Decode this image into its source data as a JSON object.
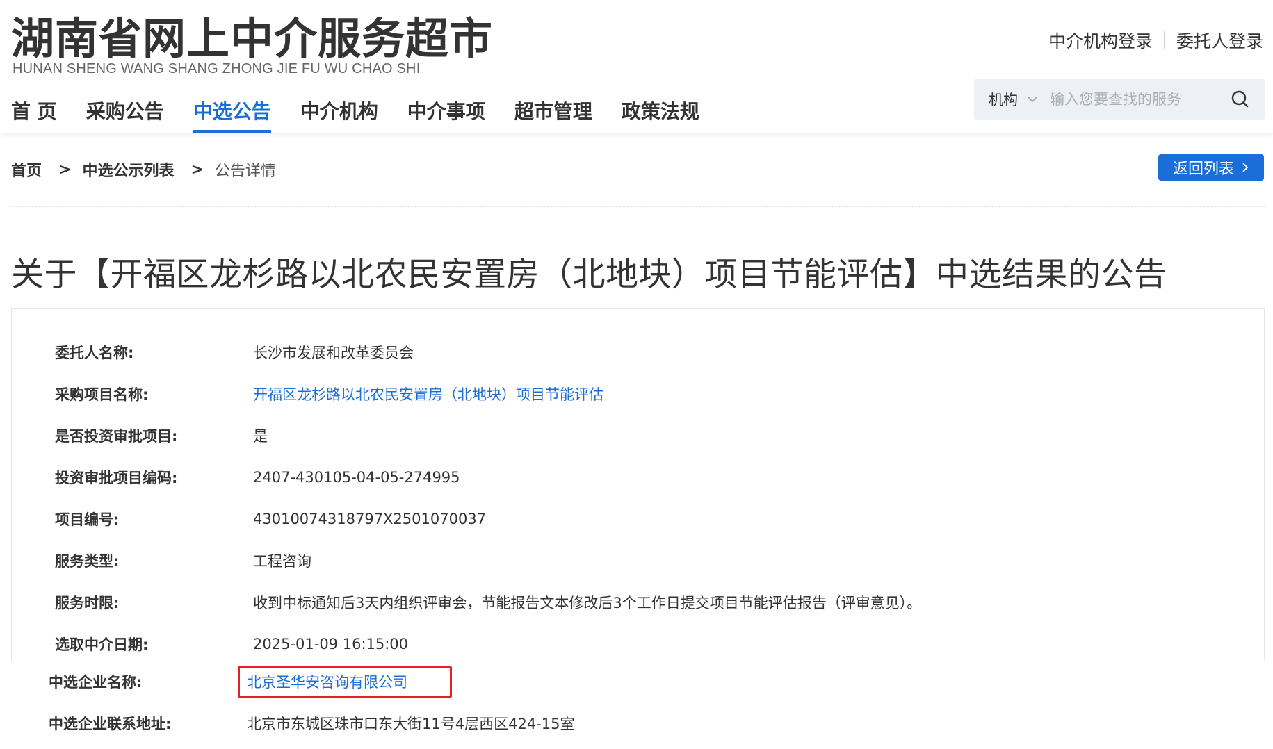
{
  "header": {
    "logo_cn": "湖南省网上中介服务超市",
    "logo_en": "HUNAN SHENG WANG SHANG ZHONG JIE FU WU CHAO SHI",
    "login_agency": "中介机构登录",
    "login_client": "委托人登录",
    "nav": [
      "首 页",
      "采购公告",
      "中选公告",
      "中介机构",
      "中介事项",
      "超市管理",
      "政策法规"
    ],
    "nav_active_index": 2,
    "search": {
      "type": "机构",
      "placeholder": "输入您要查找的服务"
    }
  },
  "breadcrumb": {
    "items": [
      "首页",
      "中选公示列表",
      "公告详情"
    ],
    "separator": ">"
  },
  "back_button": "返回列表",
  "title": "关于【开福区龙杉路以北农民安置房（北地块）项目节能评估】中选结果的公告",
  "details": [
    {
      "label": "委托人名称:",
      "value": "长沙市发展和改革委员会"
    },
    {
      "label": "采购项目名称:",
      "value": "开福区龙杉路以北农民安置房（北地块）项目节能评估"
    },
    {
      "label": "是否投资审批项目:",
      "value": "是"
    },
    {
      "label": "投资审批项目编码:",
      "value": "2407-430105-04-05-274995"
    },
    {
      "label": "项目编号:",
      "value": "43010074318797X2501070037"
    },
    {
      "label": "服务类型:",
      "value": "工程咨询"
    },
    {
      "label": "服务时限:",
      "value": "收到中标通知后3天内组织评审会，节能报告文本修改后3个工作日提交项目节能评估报告（评审意见）。"
    },
    {
      "label": "选取中介日期:",
      "value": "2025-01-09 16:15:00"
    }
  ],
  "winner": [
    {
      "label": "中选企业名称:",
      "value": "北京圣华安咨询有限公司"
    },
    {
      "label": "中选企业联系地址:",
      "value": "北京市东城区珠市口东大街11号4层西区424-15室"
    }
  ],
  "colors": {
    "accent": "#1a6ed8",
    "highlight": "#e0202a",
    "text": "#333333"
  }
}
